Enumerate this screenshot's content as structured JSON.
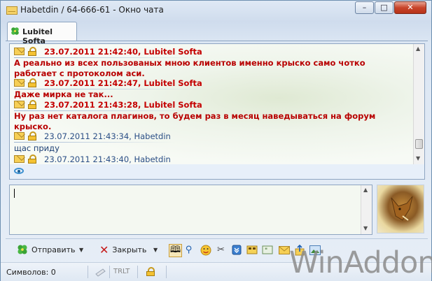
{
  "window": {
    "title": "Habetdin / 64-666-61 - Окно чата",
    "buttons": {
      "minimize": "–",
      "maximize": "□",
      "close": "✕"
    }
  },
  "tabs": [
    {
      "label": "Lubitel Softa",
      "icon": "clover-icon"
    }
  ],
  "messages": [
    {
      "header": "23.07.2011 21:42:40, Lubitel Softa",
      "style": "incoming",
      "lines": [
        "А реально из всех пользованых мною клиентов именно крыско само чотко",
        "работает с протоколом аси."
      ]
    },
    {
      "header": "23.07.2011 21:42:47, Lubitel Softa",
      "style": "incoming",
      "lines": [
        "Даже мирка не так..."
      ]
    },
    {
      "header": "23.07.2011 21:43:28, Lubitel Softa",
      "style": "incoming",
      "lines": [
        "Ну раз нет каталога плагинов, то будем раз в месяц наведываться на форум",
        "крыско."
      ]
    },
    {
      "header": "23.07.2011 21:43:34, Habetdin",
      "style": "outgoing",
      "lines": [
        "щас приду"
      ]
    },
    {
      "header": "23.07.2011 21:43:40, Habetdin",
      "style": "outgoing",
      "lines": []
    }
  ],
  "input": {
    "value": ""
  },
  "toolbar": {
    "send_label": "Отправить",
    "close_label": "Закрыть",
    "icons": [
      "history-icon",
      "search-icon",
      "smiley-icon",
      "settings-icon",
      "scroll-down-icon",
      "quote-icon",
      "comment-icon",
      "message-icon",
      "file-transfer-icon",
      "image-icon"
    ]
  },
  "status": {
    "chars_label": "Символов: 0",
    "translit": "TRLT"
  },
  "watermark": "WinAddon",
  "colors": {
    "incoming": "#c40000",
    "outgoing": "#2b4f86",
    "accent": "#8ea5c1"
  }
}
